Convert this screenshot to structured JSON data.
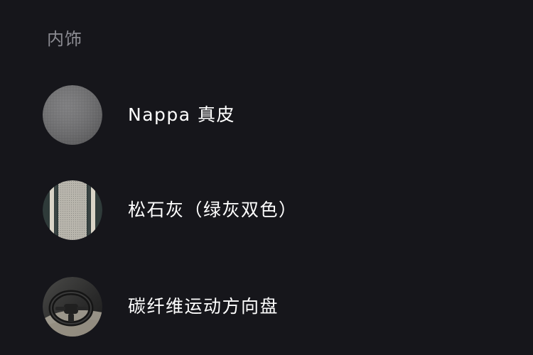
{
  "section": {
    "title": "内饰"
  },
  "options": [
    {
      "label": "Nappa 真皮",
      "swatch_icon": "gray-leather-texture"
    },
    {
      "label": "松石灰（绿灰双色）",
      "swatch_icon": "green-gray-striped-leather"
    },
    {
      "label": "碳纤维运动方向盘",
      "swatch_icon": "steering-wheel-photo"
    }
  ],
  "colors": {
    "background": "#16161b",
    "title": "#8b8b92",
    "label": "#ffffff",
    "leather_gray": "#6f6f71",
    "turquoise_stripe_dark": "#2f3b3a",
    "turquoise_stripe_light": "#d9d4c7"
  }
}
